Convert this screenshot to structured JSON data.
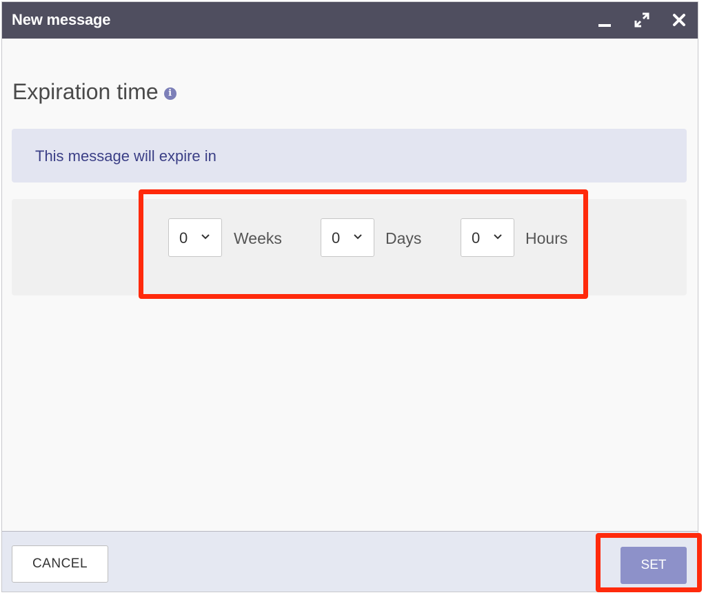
{
  "window": {
    "title": "New message",
    "controls": {
      "minimize": "minimize-icon",
      "maximize": "expand-icon",
      "close": "close-icon"
    }
  },
  "heading": {
    "text": "Expiration time",
    "info_icon": "info-icon",
    "info_glyph": "i"
  },
  "notice": {
    "text": "This message will expire in"
  },
  "expiration": {
    "weeks": {
      "value": "0",
      "label": "Weeks"
    },
    "days": {
      "value": "0",
      "label": "Days"
    },
    "hours": {
      "value": "0",
      "label": "Hours"
    }
  },
  "footer": {
    "cancel_label": "CANCEL",
    "set_label": "SET"
  },
  "colors": {
    "titlebar": "#4f4e5f",
    "notice_bg": "#e3e5f1",
    "notice_text": "#3b3f86",
    "set_button": "#8d91c9",
    "highlight": "#ff2a0c"
  }
}
